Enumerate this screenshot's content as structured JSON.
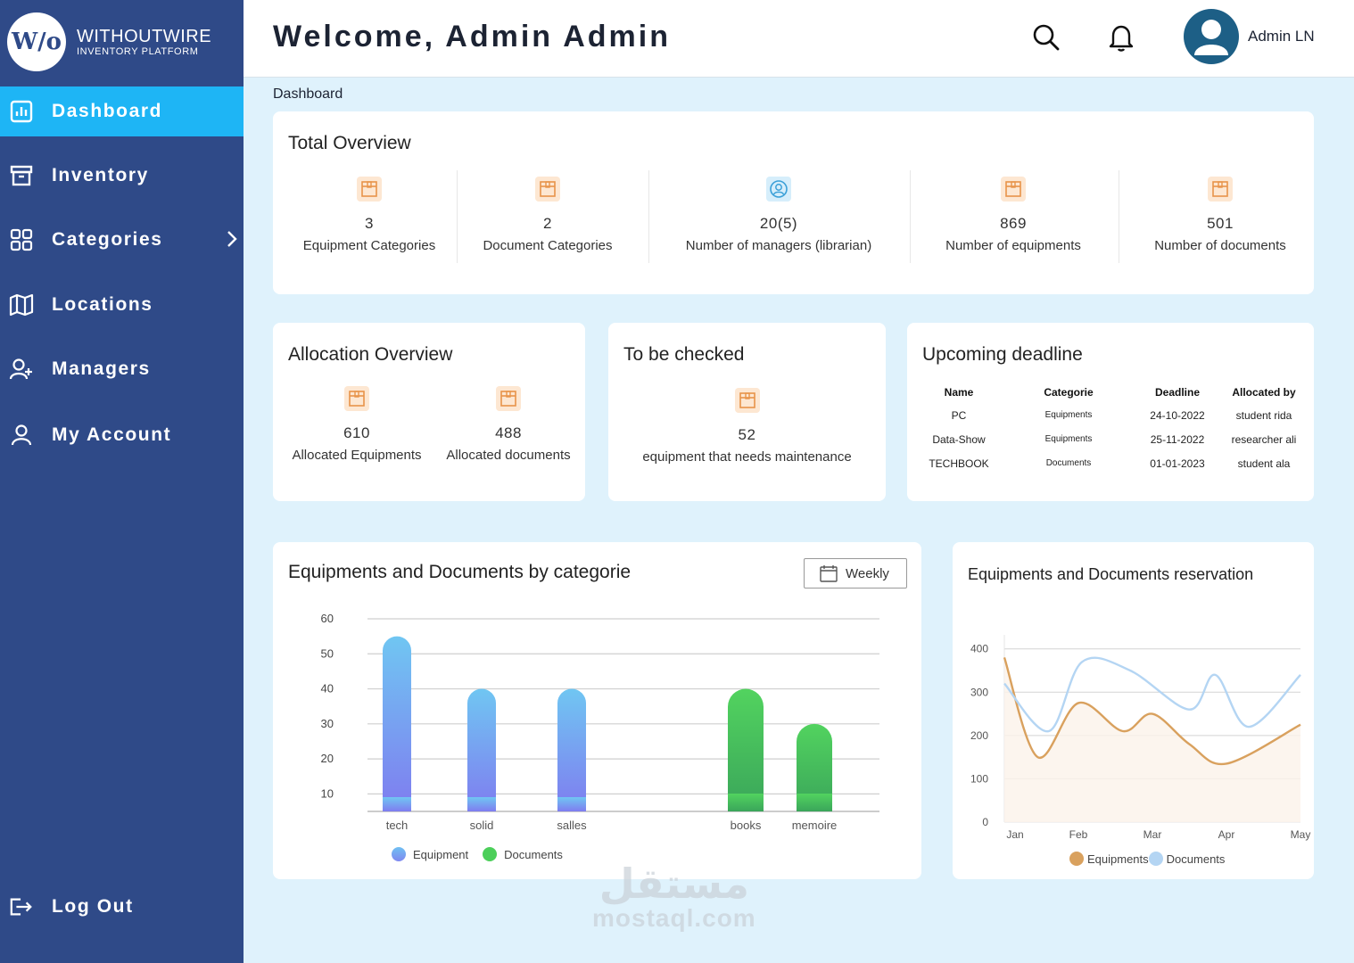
{
  "brand": {
    "logo": "W/o",
    "name": "WITHOUTWIRE",
    "subtitle": "INVENTORY PLATFORM"
  },
  "sidebar": {
    "items": [
      {
        "label": "Dashboard",
        "icon": "bar-chart-icon",
        "active": true
      },
      {
        "label": "Inventory",
        "icon": "archive-box-icon"
      },
      {
        "label": "Categories",
        "icon": "grid-icon",
        "has_submenu": true
      },
      {
        "label": "Locations",
        "icon": "map-icon"
      },
      {
        "label": "Managers",
        "icon": "user-plus-icon"
      },
      {
        "label": "My Account",
        "icon": "user-icon"
      }
    ],
    "logout": "Log Out"
  },
  "header": {
    "welcome": "Welcome, Admin Admin",
    "user_name": "Admin LN"
  },
  "breadcrumb": "Dashboard",
  "overview": {
    "title": "Total Overview",
    "stats": [
      {
        "value": "3",
        "label": "Equipment Categories",
        "icon": "box-icon"
      },
      {
        "value": "2",
        "label": "Document Categories",
        "icon": "box-icon"
      },
      {
        "value": "20(5)",
        "label": "Number of managers (librarian)",
        "icon": "user-circle-icon"
      },
      {
        "value": "869",
        "label": "Number of equipments",
        "icon": "box-icon"
      },
      {
        "value": "501",
        "label": "Number of documents",
        "icon": "box-icon"
      }
    ]
  },
  "allocation": {
    "title": "Allocation Overview",
    "stats": [
      {
        "value": "610",
        "label": "Allocated Equipments"
      },
      {
        "value": "488",
        "label": "Allocated documents"
      }
    ]
  },
  "to_check": {
    "title": "To be checked",
    "value": "52",
    "label": "equipment that needs maintenance"
  },
  "deadline": {
    "title": "Upcoming deadline",
    "columns": [
      "Name",
      "Categorie",
      "Deadline",
      "Allocated by"
    ],
    "rows": [
      [
        "PC",
        "Equipments",
        "24-10-2022",
        "student rida"
      ],
      [
        "Data-Show",
        "Equipments",
        "25-11-2022",
        "researcher ali"
      ],
      [
        "TECHBOOK",
        "Documents",
        "01-01-2023",
        "student ala"
      ]
    ]
  },
  "bar_card": {
    "title": "Equipments and Documents by categorie",
    "filter": "Weekly"
  },
  "line_card": {
    "title": "Equipments and Documents reservation"
  },
  "colors": {
    "sidebar": "#2f4a88",
    "active": "#1eb5f5",
    "equipment": "#6fb7f2",
    "documents": "#4ccf5a",
    "line_equipments": "#d9a15e",
    "line_documents": "#b4d5f3"
  },
  "chart_data": [
    {
      "type": "bar",
      "categories": [
        "tech",
        "solid",
        "salles",
        "books",
        "memoire"
      ],
      "series": [
        {
          "name": "Equipment",
          "values": [
            55,
            40,
            40,
            null,
            null
          ]
        },
        {
          "name": "Documents",
          "values": [
            null,
            null,
            null,
            40,
            30
          ]
        }
      ],
      "yticks": [
        10,
        20,
        30,
        40,
        50,
        60
      ],
      "ylim": [
        5,
        60
      ],
      "grid": true,
      "legend": "bottom"
    },
    {
      "type": "line",
      "x": [
        "Jan",
        "Feb",
        "Mar",
        "Apr",
        "May"
      ],
      "series": [
        {
          "name": "Equipments",
          "values": [
            380,
            150,
            275,
            210,
            250,
            180,
            135,
            225
          ],
          "x_pos": [
            0,
            0.45,
            1,
            1.6,
            2.0,
            2.5,
            3.0,
            4.0
          ]
        },
        {
          "name": "Documents",
          "values": [
            320,
            210,
            370,
            350,
            260,
            340,
            220,
            340
          ],
          "x_pos": [
            0,
            0.6,
            1.05,
            1.7,
            2.5,
            2.85,
            3.3,
            4.0
          ]
        }
      ],
      "yticks": [
        0,
        100,
        200,
        300,
        400
      ],
      "ylim": [
        0,
        420
      ],
      "grid": true,
      "area_fill": true,
      "legend": "bottom"
    }
  ],
  "watermark": {
    "arabic": "مستقل",
    "latin": "mostaql.com"
  }
}
